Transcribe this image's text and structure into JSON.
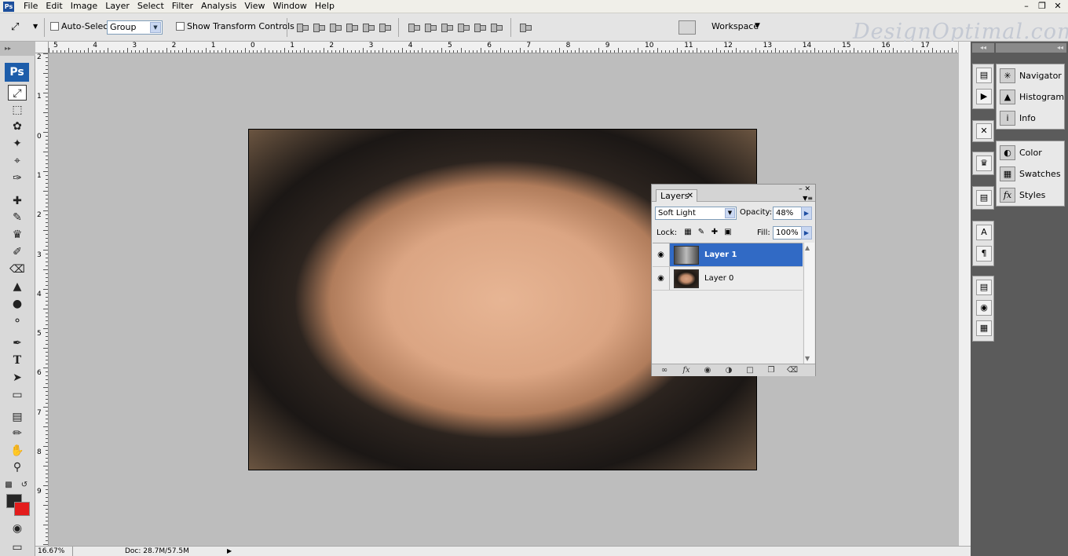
{
  "menubar": {
    "items": [
      "File",
      "Edit",
      "Image",
      "Layer",
      "Select",
      "Filter",
      "Analysis",
      "View",
      "Window",
      "Help"
    ],
    "app_icon": "Ps"
  },
  "options_bar": {
    "auto_select_label": "Auto-Select:",
    "auto_select_value": "Group",
    "show_transform_label": "Show Transform Controls",
    "workspace_label": "Workspace",
    "logo_text": "DesignOptimal.com"
  },
  "toolbox": {
    "logo": "Ps",
    "tools": [
      "move-tool",
      "marquee-tool",
      "lasso-tool",
      "magic-wand-tool",
      "crop-tool",
      "slice-tool",
      "healing-brush-tool",
      "brush-tool",
      "clone-stamp-tool",
      "history-brush-tool",
      "eraser-tool",
      "paint-bucket-tool",
      "blur-tool",
      "dodge-tool",
      "pen-tool",
      "type-tool",
      "path-selection-tool",
      "rectangle-tool",
      "notes-tool",
      "eyedropper-tool",
      "hand-tool",
      "zoom-tool"
    ],
    "foreground_color": "#262626",
    "background_color": "#e31c1c"
  },
  "rulers": {
    "top_labels": [
      "5",
      "4",
      "3",
      "2",
      "1",
      "0",
      "1",
      "2",
      "3",
      "4",
      "5",
      "6",
      "7",
      "8",
      "9",
      "10",
      "11",
      "12",
      "13",
      "14",
      "15",
      "16",
      "17"
    ],
    "left_labels": [
      "2",
      "1",
      "0",
      "1",
      "2",
      "3",
      "4",
      "5",
      "6",
      "7",
      "8",
      "9"
    ]
  },
  "status": {
    "zoom": "16.67%",
    "doc": "Doc: 28.7M/57.5M"
  },
  "layers_panel": {
    "tab_label": "Layers",
    "blend_mode": "Soft Light",
    "opacity_label": "Opacity:",
    "opacity_value": "48%",
    "lock_label": "Lock:",
    "fill_label": "Fill:",
    "fill_value": "100%",
    "layers": [
      {
        "name": "Layer 1",
        "selected": true
      },
      {
        "name": "Layer 0",
        "selected": false
      }
    ]
  },
  "right_panels": {
    "group1": [
      "Navigator",
      "Histogram",
      "Info"
    ],
    "group2": [
      "Color",
      "Swatches",
      "Styles"
    ]
  }
}
